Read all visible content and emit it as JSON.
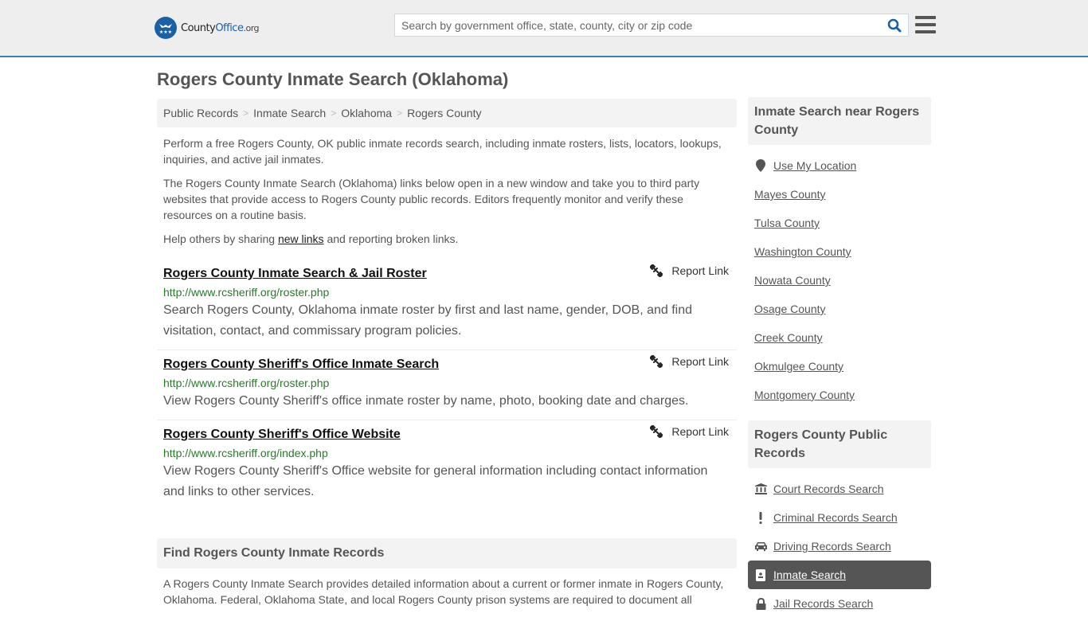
{
  "header": {
    "logo": {
      "part1": "County",
      "part2": "Office",
      "part3": ".org"
    },
    "search_placeholder": "Search by government office, state, county, city or zip code",
    "search_icon": "search-icon",
    "menu_icon": "hamburger-menu-icon"
  },
  "page_title": "Rogers County Inmate Search (Oklahoma)",
  "breadcrumb": [
    {
      "label": "Public Records"
    },
    {
      "label": "Inmate Search"
    },
    {
      "label": "Oklahoma"
    },
    {
      "label": "Rogers County"
    }
  ],
  "intro": {
    "p1": "Perform a free Rogers County, OK public inmate records search, including inmate rosters, lists, locators, lookups, inquiries, and active jail inmates.",
    "p2": "The Rogers County Inmate Search (Oklahoma) links below open in a new window and take you to third party websites that provide access to Rogers County public records. Editors frequently monitor and verify these resources on a routine basis.",
    "p3_before": "Help others by sharing ",
    "p3_link": "new links",
    "p3_after": " and reporting broken links."
  },
  "results": [
    {
      "title": "Rogers County Inmate Search & Jail Roster",
      "url": "http://www.rcsheriff.org/roster.php",
      "description": "Search Rogers County, Oklahoma inmate roster by first and last name, gender, DOB, and find visitation, contact, and commissary program policies.",
      "report_label": "Report Link"
    },
    {
      "title": "Rogers County Sheriff's Office Inmate Search",
      "url": "http://www.rcsheriff.org/roster.php",
      "description": "View Rogers County Sheriff's office inmate roster by name, photo, booking date and charges.",
      "report_label": "Report Link"
    },
    {
      "title": "Rogers County Sheriff's Office Website",
      "url": "http://www.rcsheriff.org/index.php",
      "description": "View Rogers County Sheriff's Office website for general information including contact information and links to other services.",
      "report_label": "Report Link"
    }
  ],
  "find_section": {
    "heading": "Find Rogers County Inmate Records",
    "body": "A Rogers County Inmate Search provides detailed information about a current or former inmate in Rogers County, Oklahoma. Federal, Oklahoma State, and local Rogers County prison systems are required to document all"
  },
  "sidebar": {
    "nearby": {
      "heading": "Inmate Search near Rogers County",
      "use_location": "Use My Location",
      "counties": [
        "Mayes County",
        "Tulsa County",
        "Washington County",
        "Nowata County",
        "Osage County",
        "Creek County",
        "Okmulgee County",
        "Montgomery County"
      ]
    },
    "public_records": {
      "heading": "Rogers County Public Records",
      "items": [
        {
          "label": "Court Records Search",
          "icon": "courthouse-icon",
          "active": false
        },
        {
          "label": "Criminal Records Search",
          "icon": "exclamation-icon",
          "active": false
        },
        {
          "label": "Driving Records Search",
          "icon": "car-icon",
          "active": false
        },
        {
          "label": "Inmate Search",
          "icon": "id-badge-icon",
          "active": true
        },
        {
          "label": "Jail Records Search",
          "icon": "lock-icon",
          "active": false
        }
      ]
    }
  },
  "colors": {
    "brand_blue": "#1d5fa3",
    "header_border": "#3b7fae",
    "url_green": "#2a7a2a",
    "active_bg": "#555555"
  }
}
